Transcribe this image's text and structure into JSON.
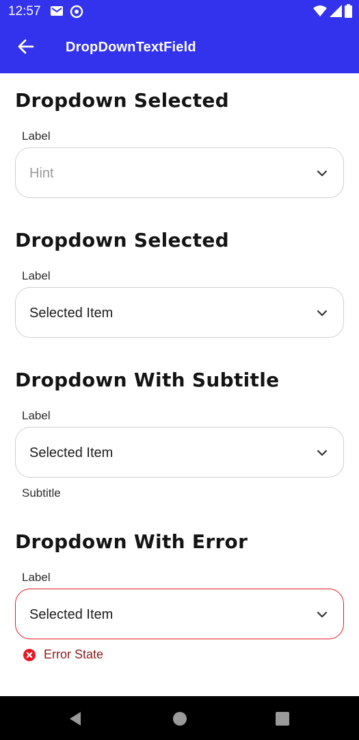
{
  "status_bar": {
    "time": "12:57",
    "icons_left": [
      "gmail-icon",
      "at-sign-icon"
    ],
    "icons_right": [
      "wifi-icon",
      "signal-icon",
      "battery-icon"
    ]
  },
  "app_bar": {
    "title": "DropDownTextField",
    "back_icon": "arrow-left-icon",
    "background": "#3333ee"
  },
  "sections": [
    {
      "title": "Dropdown Selected",
      "label": "Label",
      "value": "Hint",
      "is_hint": true
    },
    {
      "title": "Dropdown Selected",
      "label": "Label",
      "value": "Selected Item",
      "is_hint": false
    },
    {
      "title": "Dropdown With Subtitle",
      "label": "Label",
      "value": "Selected Item",
      "is_hint": false,
      "subtitle": "Subtitle"
    },
    {
      "title": "Dropdown With Error",
      "label": "Label",
      "value": "Selected Item",
      "is_hint": false,
      "error": "Error State"
    }
  ],
  "colors": {
    "accent": "#3333ee",
    "error": "#e8161f",
    "error_text": "#8b1a1a",
    "border": "#cfcfcf"
  },
  "nav_bar": {
    "buttons": [
      "back-triangle-icon",
      "home-circle-icon",
      "recents-square-icon"
    ]
  }
}
